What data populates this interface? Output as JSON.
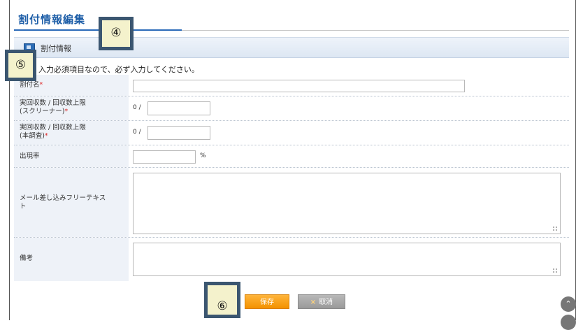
{
  "page": {
    "title": "割付情報編集"
  },
  "section": {
    "title": "割付情報"
  },
  "note": "入力必須項目なので、必ず入力してください。",
  "form": {
    "required_mark": "*",
    "allocation_name": {
      "label": "割付名"
    },
    "screener_quota": {
      "label_line1": "実回収数 / 回収数上限",
      "label_line2": "(スクリーナー)",
      "collected": "0 /",
      "value": ""
    },
    "main_quota": {
      "label_line1": "実回収数 / 回収数上限",
      "label_line2": "(本調査)",
      "collected": "0 /",
      "value": ""
    },
    "incidence_rate": {
      "label": "出現率",
      "unit": "%",
      "value": ""
    },
    "mail_free_text": {
      "label_line1": "メール差し込みフリーテキス",
      "label_line2": "ト",
      "value": ""
    },
    "remarks": {
      "label": "備考",
      "value": ""
    }
  },
  "buttons": {
    "save": "保存",
    "cancel": "取消",
    "cancel_icon": "×"
  },
  "callouts": {
    "c4": "④",
    "c5": "⑤",
    "c6": "⑥"
  },
  "scroll": {
    "up_icon": "⌃"
  }
}
